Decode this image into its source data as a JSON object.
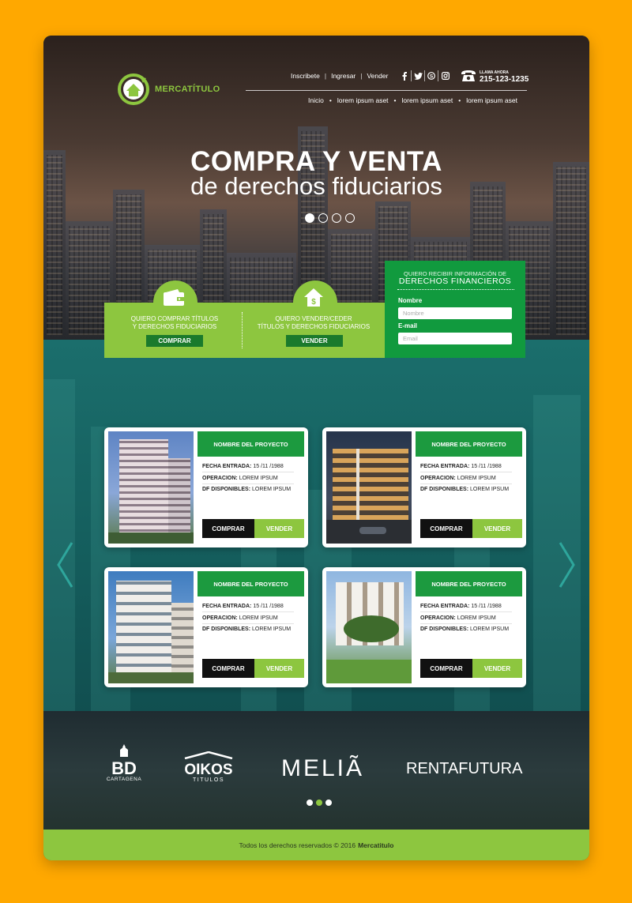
{
  "brand": {
    "name": "MERCATÍTULO"
  },
  "topnav": {
    "items": [
      "Inscribete",
      "Ingresar",
      "Vender"
    ]
  },
  "social": {
    "icons": [
      "facebook-icon",
      "twitter-icon",
      "skype-icon",
      "instagram-icon"
    ]
  },
  "phone": {
    "label": "LLAMA AHORA",
    "number": "215-123-1235"
  },
  "mainnav": {
    "items": [
      "Inicio",
      "lorem ipsum aset",
      "lorem ipsum aset",
      "lorem ipsum aset"
    ]
  },
  "hero": {
    "title": "COMPRA Y VENTA",
    "subtitle": "de derechos fiduciarios",
    "slide_count": 4,
    "active_slide": 1
  },
  "cta": {
    "buy_text_1": "QUIERO COMPRAR TÍTULOS",
    "buy_text_2": "Y DERECHOS FIDUCIARIOS",
    "buy_button": "COMPRAR",
    "sell_text_1": "QUIERO VENDER/CEDER",
    "sell_text_2": "TÍTULOS Y DERECHOS  FIDUCIARIOS",
    "sell_button": "VENDER"
  },
  "form": {
    "heading_1": "QUIERO RECIBIR INFORMACIÓN DE",
    "heading_2": "DERECHOS FINANCIEROS",
    "name_label": "Nombre",
    "name_placeholder": "Nombre",
    "email_label": "E-mail",
    "email_placeholder": "Email"
  },
  "listings": [
    {
      "title": "NOMBRE DEL PROYECTO",
      "fecha_label": "FECHA ENTRADA:",
      "fecha": "15 /11 /1988",
      "op_label": "OPERACION:",
      "op": "LOREM IPSUM",
      "df_label": "DF DISPONIBLES:",
      "df": "LOREM IPSUM",
      "buy": "COMPRAR",
      "sell": "VENDER"
    },
    {
      "title": "NOMBRE DEL PROYECTO",
      "fecha_label": "FECHA ENTRADA:",
      "fecha": "15 /11 /1988",
      "op_label": "OPERACION:",
      "op": "LOREM IPSUM",
      "df_label": "DF DISPONIBLES:",
      "df": "LOREM IPSUM",
      "buy": "COMPRAR",
      "sell": "VENDER"
    },
    {
      "title": "NOMBRE DEL PROYECTO",
      "fecha_label": "FECHA ENTRADA:",
      "fecha": "15 /11 /1988",
      "op_label": "OPERACION:",
      "op": "LOREM IPSUM",
      "df_label": "DF DISPONIBLES:",
      "df": "LOREM IPSUM",
      "buy": "COMPRAR",
      "sell": "VENDER"
    },
    {
      "title": "NOMBRE DEL PROYECTO",
      "fecha_label": "FECHA ENTRADA:",
      "fecha": "15 /11 /1988",
      "op_label": "OPERACION:",
      "op": "LOREM IPSUM",
      "df_label": "DF DISPONIBLES:",
      "df": "LOREM IPSUM",
      "buy": "COMPRAR",
      "sell": "VENDER"
    }
  ],
  "partners": {
    "bd": "BD",
    "bd_sub": "CARTAGENA",
    "oikos": "OIKOS",
    "oikos_sub": "TITULOS",
    "melia": "MELIÃ",
    "renta": "RENTAFUTURA",
    "slide_count": 3,
    "active_slide": 2
  },
  "footer": {
    "text": "Todos los derechos reservados © 2016",
    "brand": "Mercatitulo"
  },
  "colors": {
    "background": "#FFA800",
    "accent_green": "#8dc63f",
    "dark_green": "#119a3e",
    "teal": "#15605f"
  }
}
